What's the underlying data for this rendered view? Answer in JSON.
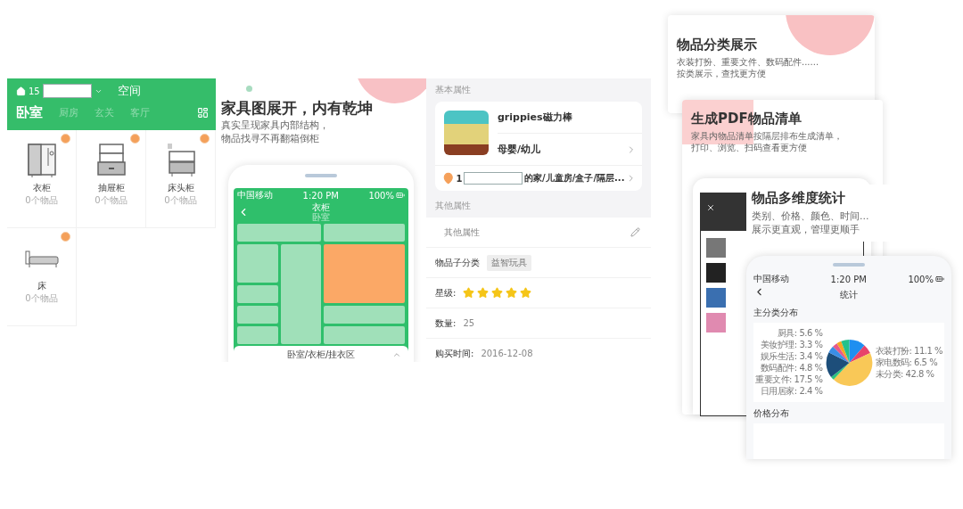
{
  "space_screen": {
    "home_prefix": "15",
    "space_label": "空间",
    "tabs": [
      {
        "label": "卧室",
        "selected": true
      },
      {
        "label": "厨房",
        "selected": false
      },
      {
        "label": "玄关",
        "selected": false
      },
      {
        "label": "客厅",
        "selected": false
      }
    ],
    "furniture": [
      {
        "kind": "wardrobe",
        "name": "衣柜",
        "count": "0个物品"
      },
      {
        "kind": "drawers",
        "name": "抽屉柜",
        "count": "0个物品"
      },
      {
        "kind": "nightstand",
        "name": "床头柜",
        "count": "0个物品"
      },
      {
        "kind": "bed",
        "name": "床",
        "count": "0个物品"
      }
    ]
  },
  "furniture_promo": {
    "title": "家具图展开，内有乾坤",
    "lines": [
      "真实呈现家具内部结构，",
      "物品找寻不再翻箱倒柜"
    ],
    "phone": {
      "status": {
        "carrier": "中国移动",
        "time": "1:20 PM",
        "battery": "100%"
      },
      "title": "衣柜",
      "subtitle": "卧室",
      "compartments": [
        {
          "selected": false
        },
        {
          "selected": false
        },
        {
          "selected": false
        },
        {
          "selected": false
        },
        {
          "selected": true
        },
        {
          "selected": false
        },
        {
          "selected": false
        },
        {
          "selected": false
        },
        {
          "selected": false
        },
        {
          "selected": false
        }
      ],
      "path": "卧室/衣柜/挂衣区"
    }
  },
  "item_detail": {
    "basic_heading": "基本属性",
    "name": "grippies磁力棒",
    "category": "母婴/幼儿",
    "location_prefix": "1",
    "location_rest": "的家/儿童房/盒子/隔层...",
    "other_heading": "其他属性",
    "other_row": "其他属性",
    "fields": [
      {
        "kind": "tag",
        "label": "物品子分类",
        "value": "益智玩具"
      },
      {
        "kind": "stars",
        "label": "星级:",
        "stars": 5
      },
      {
        "kind": "text",
        "label": "数量:",
        "value": "25"
      },
      {
        "kind": "text",
        "label": "购买时间:",
        "value": "2016-12-08"
      }
    ]
  },
  "feature_cards": [
    {
      "title": "物品分类展示",
      "lines": [
        "衣装打扮、重要文件、数码配件......",
        "按类展示，查找更方便"
      ]
    },
    {
      "title": "生成PDF物品清单",
      "lines": [
        "家具内物品清单按隔层排布生成清单，",
        "打印、浏览、扫码查看更方便"
      ]
    },
    {
      "title": "物品多维度统计",
      "lines": [
        "类别、价格、颜色、时间...",
        "展示更直观，管理更顺手"
      ]
    }
  ],
  "stats_phone": {
    "status": {
      "carrier": "中国移动",
      "time": "1:20 PM",
      "battery": "100%"
    },
    "title": "统计",
    "pie_heading": "主分类分布",
    "chart_data": {
      "type": "pie",
      "categories": [
        "衣装打扮: 11.1 %",
        "家电数码: 6.5 %",
        "未分类: 42.8 %",
        "日用居家: 2.4 %",
        "重要文件: 17.5 %",
        "数码配件: 4.8 %",
        "娱乐生活: 3.4 %",
        "美妆护理: 3.3 %",
        "厨具: 5.6 %"
      ],
      "values": [
        11.1,
        6.5,
        42.8,
        2.4,
        17.5,
        4.8,
        3.4,
        3.3,
        5.6
      ]
    },
    "price_heading": "价格分布"
  }
}
